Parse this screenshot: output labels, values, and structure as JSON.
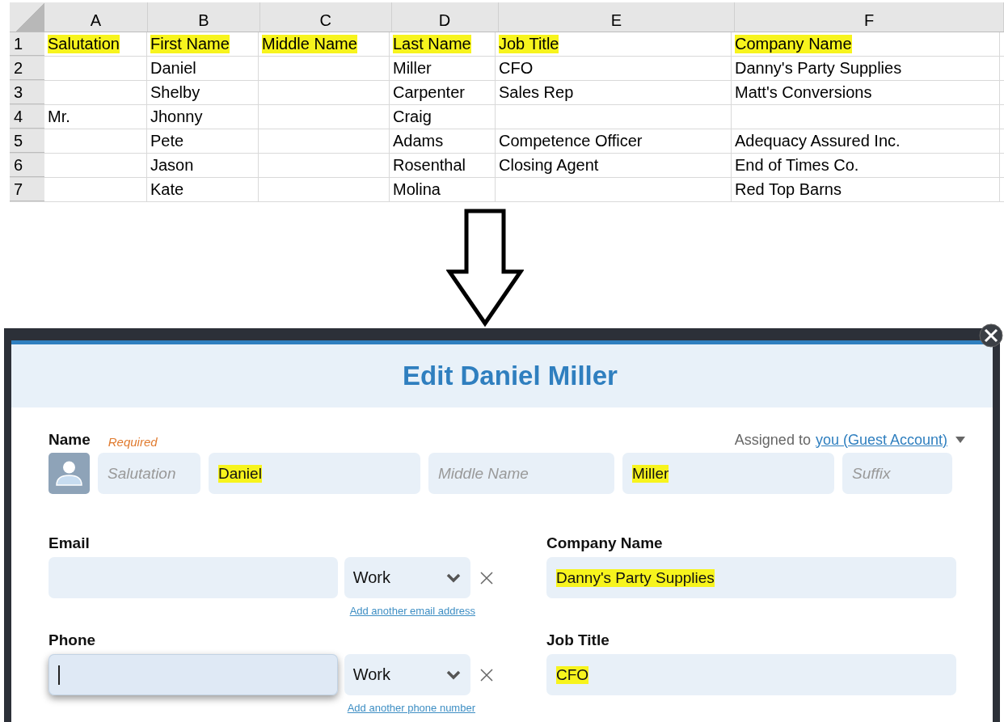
{
  "spreadsheet": {
    "columns": [
      "A",
      "B",
      "C",
      "D",
      "E",
      "F"
    ],
    "header_row": {
      "number": "1",
      "cells": [
        {
          "text": "Salutation",
          "highlighted": true
        },
        {
          "text": "First Name",
          "highlighted": true
        },
        {
          "text": "Middle Name",
          "highlighted": true
        },
        {
          "text": "Last Name",
          "highlighted": true
        },
        {
          "text": "Job Title",
          "highlighted": true
        },
        {
          "text": "Company Name",
          "highlighted": true
        }
      ]
    },
    "rows": [
      {
        "number": "2",
        "cells": [
          "",
          "Daniel",
          "",
          "Miller",
          "CFO",
          "Danny's Party Supplies"
        ]
      },
      {
        "number": "3",
        "cells": [
          "",
          "Shelby",
          "",
          "Carpenter",
          "Sales Rep",
          "Matt's Conversions"
        ]
      },
      {
        "number": "4",
        "cells": [
          "Mr.",
          "Jhonny",
          "",
          "Craig",
          "",
          ""
        ]
      },
      {
        "number": "5",
        "cells": [
          "",
          "Pete",
          "",
          "Adams",
          "Competence Officer",
          "Adequacy Assured Inc."
        ]
      },
      {
        "number": "6",
        "cells": [
          "",
          "Jason",
          "",
          "Rosenthal",
          "Closing Agent",
          "End of Times Co."
        ]
      },
      {
        "number": "7",
        "cells": [
          "",
          "Kate",
          "",
          "Molina",
          "",
          "Red Top Barns"
        ]
      }
    ]
  },
  "dialog": {
    "title": "Edit Daniel Miller",
    "name_label": "Name",
    "required": "Required",
    "assigned_prefix": "Assigned to",
    "assigned_link": "you (Guest Account)",
    "name_fields": [
      {
        "placeholder": "Salutation"
      },
      {
        "value": "Daniel",
        "highlighted": true
      },
      {
        "placeholder": "Middle Name"
      },
      {
        "value": "Miller",
        "highlighted": true
      },
      {
        "placeholder": "Suffix"
      }
    ],
    "contact_groups": [
      {
        "label": "Email",
        "type_value": "Work",
        "focused": false,
        "add_link": "Add another email address"
      },
      {
        "label": "Phone",
        "type_value": "Work",
        "focused": true,
        "add_link": "Add another phone number"
      }
    ],
    "right_fields": [
      {
        "label": "Company Name",
        "value": "Danny's Party Supplies",
        "highlighted": true
      },
      {
        "label": "Job Title",
        "value": "CFO",
        "highlighted": true
      }
    ]
  }
}
